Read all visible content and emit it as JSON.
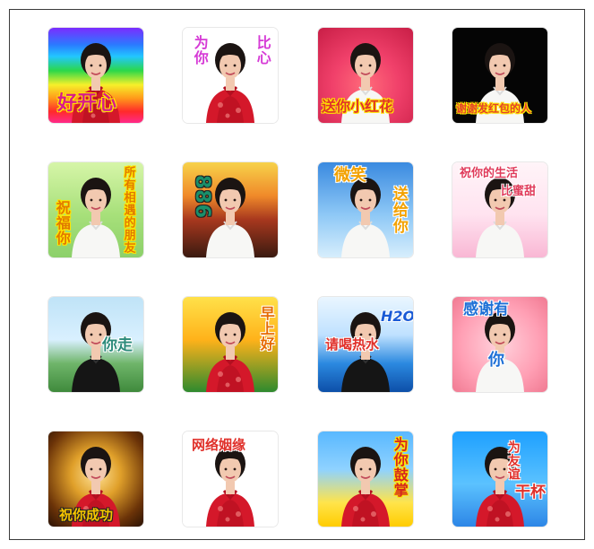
{
  "stickers": [
    {
      "caption": "好开心",
      "caption_color": "#d81b8a"
    },
    {
      "caption_left": "为你",
      "caption_right": "比心",
      "caption_color": "#d63bd6"
    },
    {
      "caption": "送你小红花",
      "caption_color": "#e0332a"
    },
    {
      "caption": "谢谢发红包的人",
      "caption_color": "#e3442a"
    },
    {
      "caption_left": "祝福你",
      "caption_right": "所有相遇的朋友",
      "caption_color": "#e07a00"
    },
    {
      "caption": "886",
      "caption_color": "#1a8f6a"
    },
    {
      "caption_top": "微笑",
      "caption_right": "送给你",
      "caption_color": "#f2a100"
    },
    {
      "caption_top": "祝你的生活",
      "caption_right": "比蜜甜",
      "caption_color": "#e03a5a"
    },
    {
      "caption": "你走",
      "caption_color": "#2b8a7a"
    },
    {
      "caption": "早上好",
      "caption_color": "#e66a00"
    },
    {
      "caption_top": "H2O",
      "caption": "请喝热水",
      "caption_color": "#e0302a"
    },
    {
      "caption_top": "感谢有",
      "caption": "你",
      "caption_color": "#1d6fd6"
    },
    {
      "caption": "祝你成功",
      "caption_color": "#f5c400"
    },
    {
      "caption_top": "网络姻缘",
      "caption_color": "#e0302a"
    },
    {
      "caption": "为你鼓掌",
      "caption_color": "#d4261f"
    },
    {
      "caption_top": "为友谊",
      "caption": "干杯",
      "caption_color": "#e0302a"
    }
  ]
}
